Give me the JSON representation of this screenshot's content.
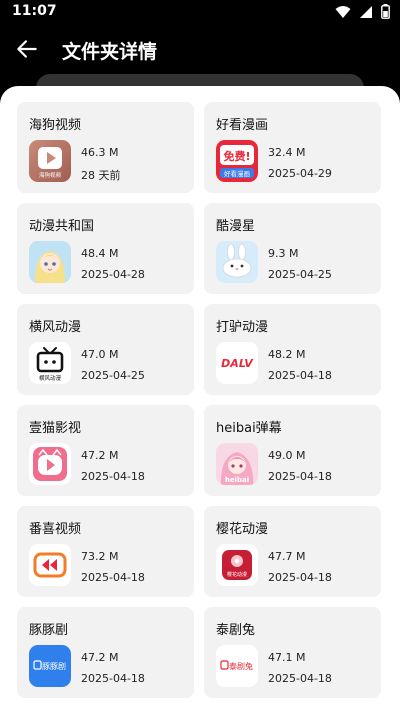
{
  "status": {
    "time": "11:07"
  },
  "header": {
    "title": "文件夹详情"
  },
  "apps": [
    {
      "name": "海狗视频",
      "size": "46.3 M",
      "date": "28 天前",
      "icon": "haigou-video-icon"
    },
    {
      "name": "好看漫画",
      "size": "32.4 M",
      "date": "2025-04-29",
      "icon": "haokan-manhua-icon"
    },
    {
      "name": "动漫共和国",
      "size": "48.4 M",
      "date": "2025-04-28",
      "icon": "dongman-gongheguo-icon"
    },
    {
      "name": "酷漫星",
      "size": "9.3 M",
      "date": "2025-04-25",
      "icon": "kumanxing-icon"
    },
    {
      "name": "横风动漫",
      "size": "47.0 M",
      "date": "2025-04-25",
      "icon": "hengfeng-dongman-icon"
    },
    {
      "name": "打驴动漫",
      "size": "48.2 M",
      "date": "2025-04-18",
      "icon": "dalv-dongman-icon"
    },
    {
      "name": "壹猫影视",
      "size": "47.2 M",
      "date": "2025-04-18",
      "icon": "yimao-yingshi-icon"
    },
    {
      "name": "heibai弹幕",
      "size": "49.0 M",
      "date": "2025-04-18",
      "icon": "heibai-danmu-icon"
    },
    {
      "name": "番喜视频",
      "size": "73.2 M",
      "date": "2025-04-18",
      "icon": "fanxi-video-icon"
    },
    {
      "name": "樱花动漫",
      "size": "47.7 M",
      "date": "2025-04-18",
      "icon": "yinghua-dongman-icon"
    },
    {
      "name": "豚豚剧",
      "size": "47.2 M",
      "date": "2025-04-18",
      "icon": "tuntunju-icon"
    },
    {
      "name": "泰剧兔",
      "size": "47.1 M",
      "date": "2025-04-18",
      "icon": "taijutu-icon"
    }
  ],
  "icon_text": {
    "haigou": "海狗视频",
    "haokan_top": "免费!",
    "haokan_bottom": "好看漫画",
    "hengfeng": "横风动漫",
    "dalv": "DALV",
    "heibai": "heibai",
    "yinghua": "樱花动漫",
    "tuntun": "豚豚剧",
    "taiju": "泰剧兔"
  }
}
